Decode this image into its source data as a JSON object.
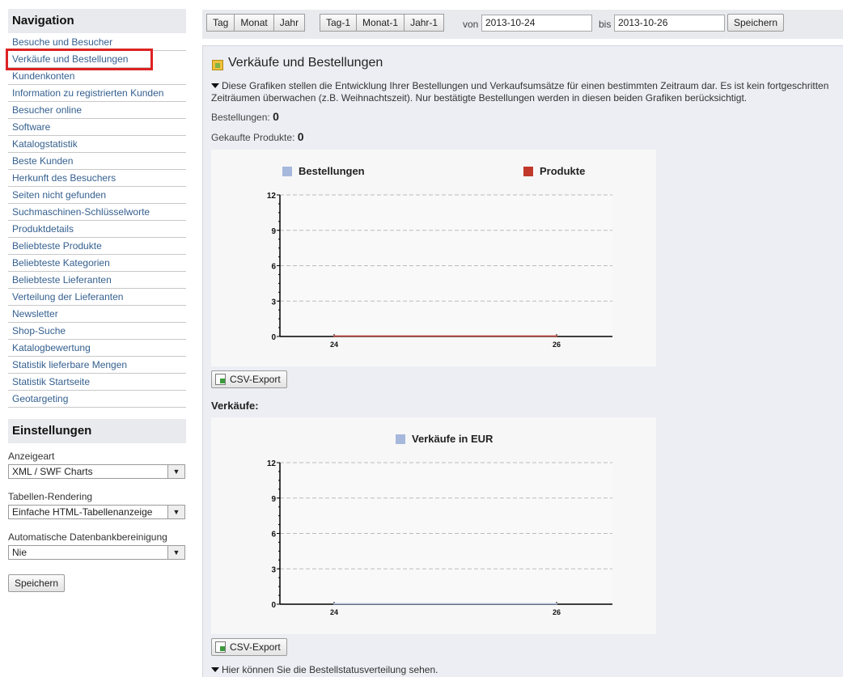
{
  "sidebar": {
    "nav_title": "Navigation",
    "items": [
      {
        "label": "Besuche und Besucher"
      },
      {
        "label": "Verkäufe und Bestellungen",
        "active": true
      },
      {
        "label": "Kundenkonten"
      },
      {
        "label": "Information zu registrierten Kunden"
      },
      {
        "label": "Besucher online"
      },
      {
        "label": "Software"
      },
      {
        "label": "Katalogstatistik"
      },
      {
        "label": "Beste Kunden"
      },
      {
        "label": "Herkunft des Besuchers"
      },
      {
        "label": "Seiten nicht gefunden"
      },
      {
        "label": "Suchmaschinen-Schlüsselworte"
      },
      {
        "label": "Produktdetails"
      },
      {
        "label": "Beliebteste Produkte"
      },
      {
        "label": "Beliebteste Kategorien"
      },
      {
        "label": "Beliebteste Lieferanten"
      },
      {
        "label": "Verteilung der Lieferanten"
      },
      {
        "label": "Newsletter"
      },
      {
        "label": "Shop-Suche"
      },
      {
        "label": "Katalogbewertung"
      },
      {
        "label": "Statistik lieferbare Mengen"
      },
      {
        "label": "Statistik Startseite"
      },
      {
        "label": "Geotargeting"
      }
    ],
    "settings_title": "Einstellungen",
    "settings": {
      "display_label": "Anzeigeart",
      "display_value": "XML / SWF Charts",
      "table_label": "Tabellen-Rendering",
      "table_value": "Einfache HTML-Tabellenanzeige",
      "cleanup_label": "Automatische Datenbankbereinigung",
      "cleanup_value": "Nie",
      "save_label": "Speichern"
    }
  },
  "toolbar": {
    "period_buttons": [
      "Tag",
      "Monat",
      "Jahr"
    ],
    "prev_buttons": [
      "Tag-1",
      "Monat-1",
      "Jahr-1"
    ],
    "from_label": "von",
    "from_value": "2013-10-24",
    "to_label": "bis",
    "to_value": "2013-10-26",
    "save_label": "Speichern"
  },
  "main": {
    "title": "Verkäufe und Bestellungen",
    "description_line1": "Diese Grafiken stellen die Entwicklung Ihrer Bestellungen und Verkaufsumsätze für einen bestimmten Zeitraum dar. Es ist kein fortgeschritten",
    "description_line2": "Zeiträumen überwachen (z.B. Weihnachtszeit). Nur bestätigte Bestellungen werden in diesen beiden Grafiken berücksichtigt.",
    "orders_label": "Bestellungen:",
    "orders_value": "0",
    "products_label": "Gekaufte Produkte:",
    "products_value": "0",
    "csv_label": "CSV-Export",
    "sales_label": "Verkäufe:",
    "footer_note": "Hier können Sie die Bestellstatusverteilung sehen."
  },
  "colors": {
    "series_blue": "#a6b8dc",
    "series_red": "#c0392b"
  },
  "chart_data": [
    {
      "type": "line",
      "x": [
        "24",
        "26"
      ],
      "series": [
        {
          "name": "Bestellungen",
          "values": [
            0,
            0
          ],
          "color": "#a6b8dc"
        },
        {
          "name": "Produkte",
          "values": [
            0,
            0
          ],
          "color": "#c0392b"
        }
      ],
      "ylim": [
        0,
        12
      ],
      "yticks": [
        0,
        3,
        6,
        9,
        12
      ],
      "grid": true,
      "legend": "top"
    },
    {
      "type": "line",
      "x": [
        "24",
        "26"
      ],
      "series": [
        {
          "name": "Verkäufe in EUR",
          "values": [
            0,
            0
          ],
          "color": "#a6b8dc"
        }
      ],
      "ylim": [
        0,
        12
      ],
      "yticks": [
        0,
        3,
        6,
        9,
        12
      ],
      "grid": true,
      "legend": "top"
    }
  ]
}
